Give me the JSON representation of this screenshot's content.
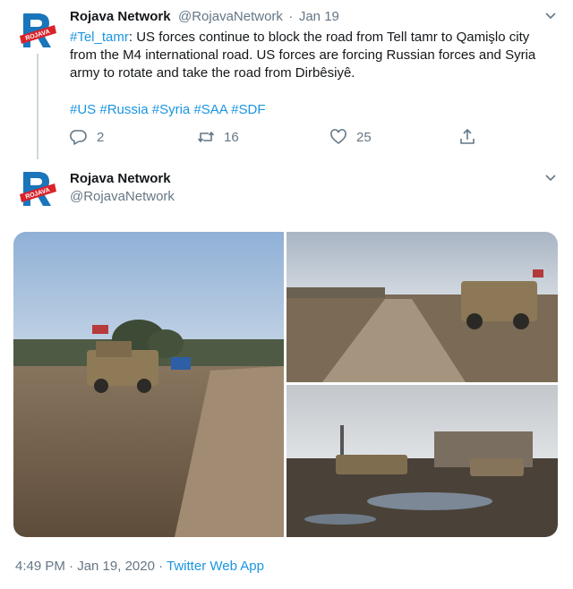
{
  "tweet1": {
    "author_name": "Rojava Network",
    "author_handle": "@RojavaNetwork",
    "separator": "·",
    "date": "Jan 19",
    "hashtag_lead": "#Tel_tamr",
    "body": ": US forces continue to block the road from Tell tamr to Qamişlo city from the M4 international road. US forces are forcing Russian forces and Syria army to rotate and take the road from Dirbêsiyê.",
    "hashtags": [
      "#US",
      "#Russia",
      "#Syria",
      "#SAA",
      "#SDF"
    ],
    "reply_count": "2",
    "retweet_count": "16",
    "like_count": "25"
  },
  "tweet2": {
    "author_name": "Rojava Network",
    "author_handle": "@RojavaNetwork",
    "timestamp": "4:49 PM · Jan 19, 2020",
    "separator": "·",
    "source": "Twitter Web App"
  },
  "avatar_logo_text": "ROJAVA",
  "colors": {
    "link": "#1b95e0",
    "text": "#14171a",
    "muted": "#657786",
    "logo_red": "#d8232a",
    "logo_blue": "#1a75bb"
  },
  "icons": [
    "chevron-down-icon",
    "reply-icon",
    "retweet-icon",
    "like-icon",
    "share-icon"
  ]
}
